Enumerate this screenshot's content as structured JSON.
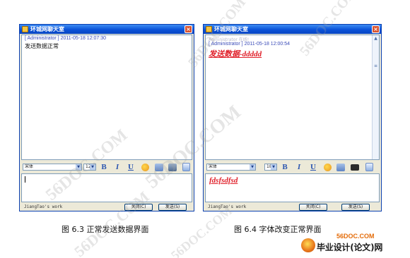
{
  "window": {
    "title": "环城网聊天室",
    "close_glyph": "×"
  },
  "left": {
    "faint_line": "",
    "message": {
      "header": "[ Administrator ] 2011-05-18 12:07:30",
      "body": "发送数据正常"
    },
    "font_name": "宋体",
    "font_size": "12",
    "input_text": "",
    "footer_note": "JiangTao's work",
    "close_label": "关闭(C)",
    "send_label": "发送(S)"
  },
  "right": {
    "faint_line": "Administrator 在线!",
    "message": {
      "header": "[ Administrator ] 2011-05-18 12:00:54",
      "body": "发送数据-ddddd"
    },
    "font_name": "宋体",
    "font_size": "18",
    "input_text": "fdsfsdfsd",
    "footer_note": "JiangTao's work",
    "close_label": "关闭(C)",
    "send_label": "发送(S)"
  },
  "toolbar": {
    "bold": "B",
    "italic": "I",
    "underline": "U",
    "icons": [
      "color-palette-icon",
      "emoticon-icon",
      "screenshot-icon",
      "computer-icon",
      "transparency-icon"
    ]
  },
  "captions": {
    "left": "图 6.3    正常发送数据界面",
    "right": "图 6.4    字体改变正常界面"
  },
  "watermark_text": "56DOC.COM",
  "logo": {
    "top": "56DOC.COM",
    "main": "毕业设计(论文)网"
  }
}
